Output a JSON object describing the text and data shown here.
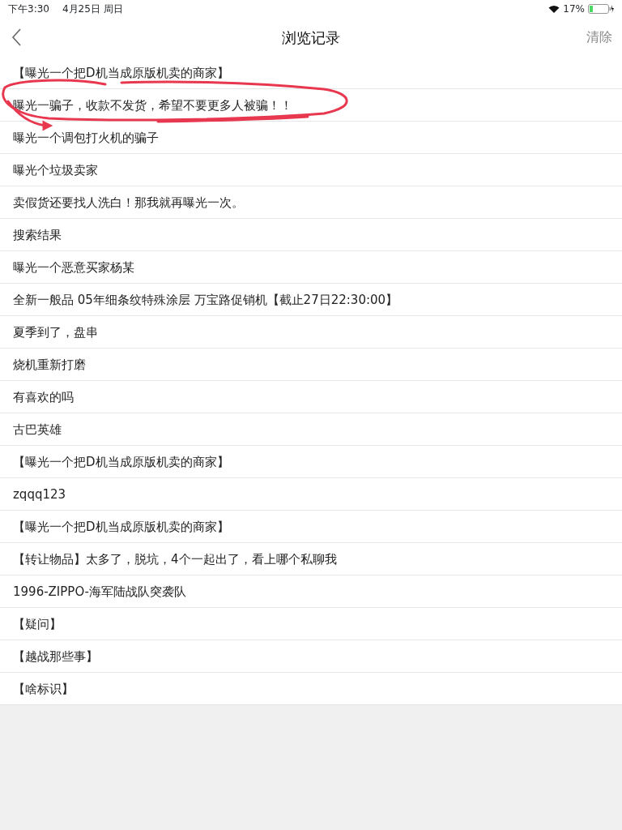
{
  "status_bar": {
    "time": "下午3:30",
    "date": "4月25日 周日",
    "battery": "17%"
  },
  "nav": {
    "title": "浏览记录",
    "action": "清除"
  },
  "history": [
    {
      "title": "【曝光一个把D机当成原版机卖的商家】"
    },
    {
      "title": "曝光一骗子，收款不发货，希望不要更多人被骗！！"
    },
    {
      "title": "曝光一个调包打火机的骗子"
    },
    {
      "title": "曝光个垃圾卖家"
    },
    {
      "title": "卖假货还要找人洗白！那我就再曝光一次。"
    },
    {
      "title": "搜索结果"
    },
    {
      "title": "曝光一个恶意买家杨某"
    },
    {
      "title": "全新一般品 05年细条纹特殊涂层 万宝路促销机【截止27日22:30:00】"
    },
    {
      "title": "夏季到了，盘串"
    },
    {
      "title": "烧机重新打磨"
    },
    {
      "title": "有喜欢的吗"
    },
    {
      "title": "古巴英雄"
    },
    {
      "title": "【曝光一个把D机当成原版机卖的商家】"
    },
    {
      "title": "zqqq123"
    },
    {
      "title": "【曝光一个把D机当成原版机卖的商家】"
    },
    {
      "title": "【转让物品】太多了，脱坑，4个一起出了，看上哪个私聊我"
    },
    {
      "title": "1996-ZIPPO-海军陆战队突袭队"
    },
    {
      "title": "【疑问】"
    },
    {
      "title": "【越战那些事】"
    },
    {
      "title": "【啥标识】"
    }
  ]
}
